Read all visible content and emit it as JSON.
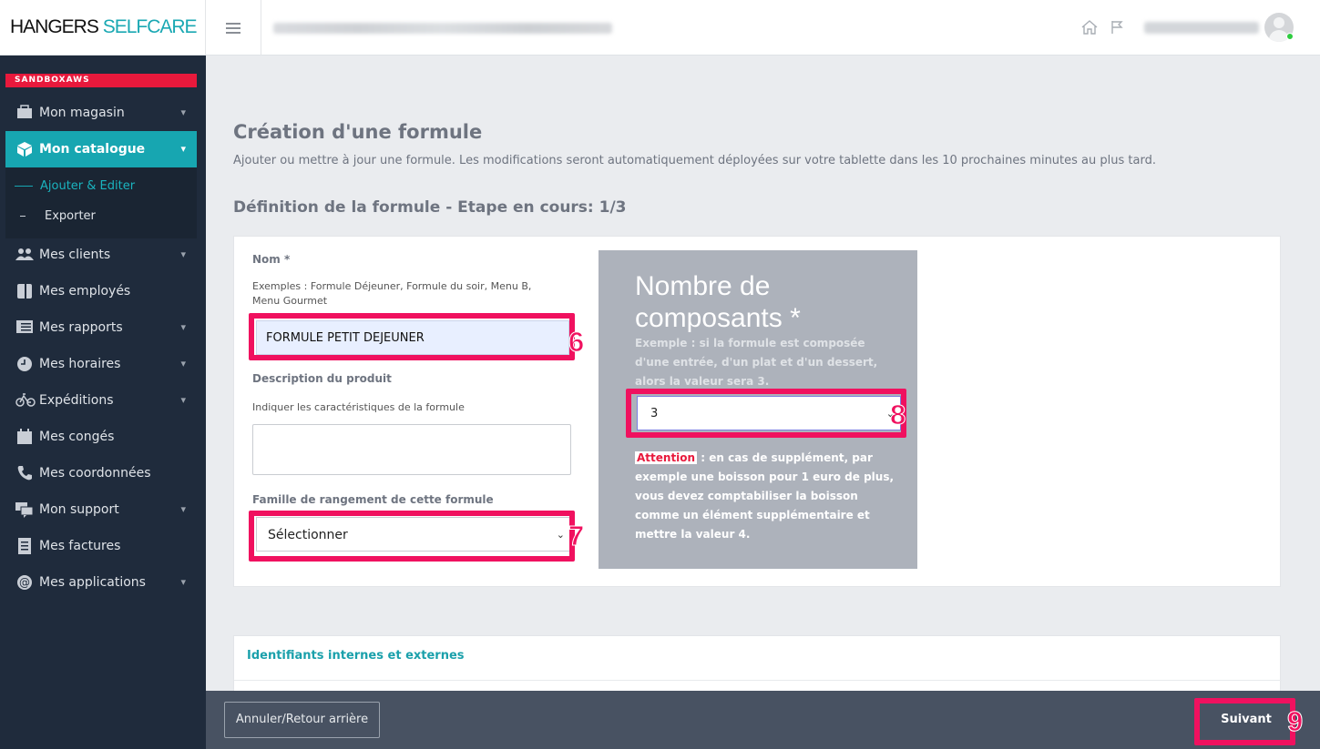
{
  "header": {
    "logo_part1": "HANGERS",
    "logo_part2": "SELFCARE",
    "home_icon": "home-icon",
    "flag_icon": "flag-icon"
  },
  "sidebar": {
    "env_tag": "SANDBOXAWS",
    "items": [
      {
        "label": "Mon magasin",
        "icon": "store-icon",
        "chevron": "▾"
      },
      {
        "label": "Mon catalogue",
        "icon": "cube-icon",
        "chevron": "▾"
      },
      {
        "label": "Mes clients",
        "icon": "users-icon",
        "chevron": "▾"
      },
      {
        "label": "Mes employés",
        "icon": "badge-icon",
        "chevron": ""
      },
      {
        "label": "Mes rapports",
        "icon": "list-icon",
        "chevron": "▾"
      },
      {
        "label": "Mes horaires",
        "icon": "clock-icon",
        "chevron": "▾"
      },
      {
        "label": "Expéditions",
        "icon": "bicycle-icon",
        "chevron": "▾"
      },
      {
        "label": "Mes congés",
        "icon": "calendar-icon",
        "chevron": ""
      },
      {
        "label": "Mes coordonnées",
        "icon": "phone-icon",
        "chevron": ""
      },
      {
        "label": "Mon support",
        "icon": "chat-icon",
        "chevron": "▾"
      },
      {
        "label": "Mes factures",
        "icon": "invoice-icon",
        "chevron": ""
      },
      {
        "label": "Mes applications",
        "icon": "at-icon",
        "chevron": "▾"
      }
    ],
    "submenu": [
      {
        "label": "Ajouter & Editer"
      },
      {
        "label": "Exporter"
      }
    ]
  },
  "main": {
    "title": "Création d'une formule",
    "subtitle": "Ajouter ou mettre à jour une formule. Les modifications seront automatiquement déployées sur votre tablette dans les 10 prochaines minutes au plus tard.",
    "section_title": "Définition de la formule - Etape en cours: 1/3",
    "form": {
      "name_label": "Nom *",
      "name_help": "Exemples : Formule Déjeuner, Formule du soir, Menu B, Menu Gourmet",
      "name_value": "FORMULE PETIT DEJEUNER",
      "desc_label": "Description du produit",
      "desc_help": "Indiquer les caractéristiques de la formule",
      "desc_value": "",
      "family_label": "Famille de rangement de cette formule",
      "family_value": "Sélectionner"
    },
    "components": {
      "title": "Nombre de composants *",
      "help": "Exemple : si la formule est composée d'une entrée, d'un plat et d'un dessert, alors la valeur sera 3.",
      "value": "3",
      "attention_tag": "Attention",
      "attention_text": " : en cas de supplément, par exemple une boisson pour 1 euro de plus, vous devez comptabiliser la boisson comme un élément supplémentaire et mettre la valeur 4."
    },
    "ids_card_title": "Identifiants internes et externes"
  },
  "footer": {
    "back_label": "Annuler/Retour arrière",
    "next_label": "Suivant"
  },
  "annotations": {
    "n6": "6",
    "n7": "7",
    "n8": "8",
    "n9": "9"
  },
  "colors": {
    "brand": "#1aa8b3",
    "sidebar_bg": "#1f2b3c",
    "highlight": "#f0115f",
    "env_tag": "#e8193c"
  }
}
